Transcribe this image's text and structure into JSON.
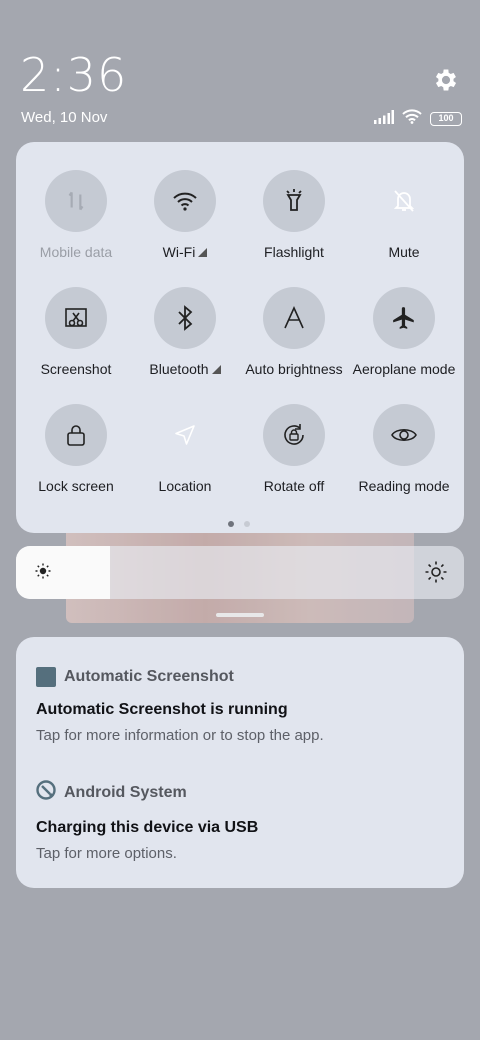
{
  "status": {
    "time": "2:36",
    "date": "Wed, 10 Nov",
    "battery": "100"
  },
  "quick_settings": {
    "tiles": [
      {
        "label": "Mobile data",
        "icon": "mobile-data-icon",
        "active": false,
        "dim": true
      },
      {
        "label": "Wi-Fi",
        "icon": "wifi-icon",
        "active": true,
        "expand": true
      },
      {
        "label": "Flashlight",
        "icon": "flashlight-icon",
        "active": true
      },
      {
        "label": "Mute",
        "icon": "mute-bell-icon",
        "active": false
      },
      {
        "label": "Screenshot",
        "icon": "screenshot-icon",
        "active": true
      },
      {
        "label": "Bluetooth",
        "icon": "bluetooth-icon",
        "active": true,
        "expand": true
      },
      {
        "label": "Auto brightness",
        "icon": "auto-brightness-icon",
        "active": true
      },
      {
        "label": "Aeroplane mode",
        "icon": "aeroplane-icon",
        "active": true
      },
      {
        "label": "Lock screen",
        "icon": "lock-icon",
        "active": true
      },
      {
        "label": "Location",
        "icon": "location-icon",
        "active": false
      },
      {
        "label": "Rotate off",
        "icon": "rotate-lock-icon",
        "active": true
      },
      {
        "label": "Reading mode",
        "icon": "eye-icon",
        "active": true
      }
    ],
    "page_count": 2,
    "current_page": 1
  },
  "brightness": {
    "level_fraction": 0.21
  },
  "notifications": [
    {
      "app": "Automatic Screenshot",
      "title": "Automatic Screenshot is running",
      "body": "Tap for more information or to stop the app."
    },
    {
      "app": "Android System",
      "title": "Charging this device via USB",
      "body": "Tap for more options."
    }
  ]
}
